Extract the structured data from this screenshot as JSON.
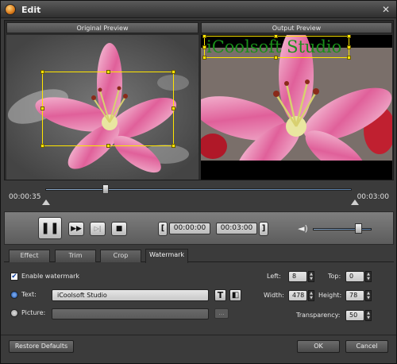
{
  "window": {
    "title": "Edit",
    "close_glyph": "✕"
  },
  "preview": {
    "original_label": "Original Preview",
    "output_label": "Output Preview"
  },
  "watermark_overlay_text": "iCoolsoft Studio",
  "timeline": {
    "current_time": "00:00:35",
    "total_time": "00:03:00",
    "position_fraction": 0.19
  },
  "controls": {
    "pause_glyph": "❚❚",
    "ff_glyph": "▶▶",
    "next_glyph": "▷|",
    "stop_glyph": "■",
    "start_mark_glyph": "[",
    "end_mark_glyph": "]",
    "start_time": "00:00:00",
    "end_time": "00:03:00",
    "volume_icon": "speaker-icon",
    "volume_glyph": "◄)",
    "volume_fraction": 0.85
  },
  "tabs": [
    {
      "label": "Effect"
    },
    {
      "label": "Trim"
    },
    {
      "label": "Crop"
    },
    {
      "label": "Watermark",
      "active": true
    }
  ],
  "watermark": {
    "enable_label": "Enable watermark",
    "enable_checked": true,
    "check_glyph": "✔",
    "text_label": "Text:",
    "text_value": "iCoolsoft Studio",
    "text_selected": true,
    "font_button_glyph": "T",
    "color_button_glyph": "◧",
    "picture_label": "Picture:",
    "picture_value": "",
    "browse_glyph": "...",
    "left_label": "Left:",
    "left_value": "8",
    "top_label": "Top:",
    "top_value": "0",
    "width_label": "Width:",
    "width_value": "478",
    "height_label": "Height:",
    "height_value": "78",
    "transparency_label": "Transparency:",
    "transparency_value": "50",
    "spin_up": "▲",
    "spin_down": "▼"
  },
  "footer": {
    "restore_label": "Restore Defaults",
    "ok_label": "OK",
    "cancel_label": "Cancel"
  },
  "colors": {
    "accent_selection": "#ffe600",
    "watermark_text": "#1a8f1a",
    "flower_pink": "#e0609a"
  }
}
